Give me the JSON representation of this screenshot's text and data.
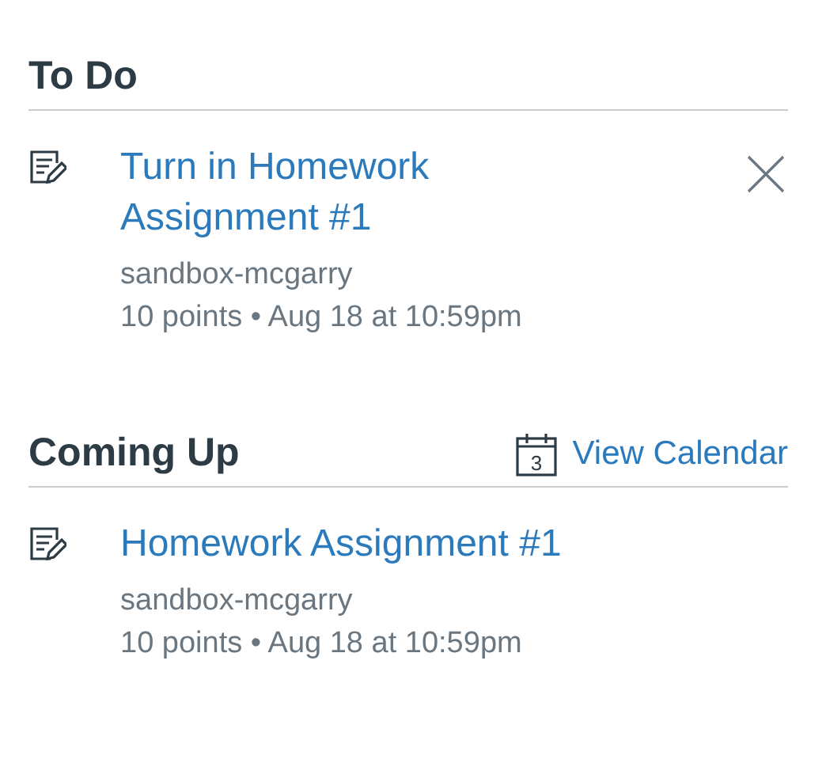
{
  "todo": {
    "title": "To Do",
    "items": [
      {
        "title": "Turn in Homework Assignment #1",
        "course": "sandbox-mcgarry",
        "meta": "10 points • Aug 18 at 10:59pm",
        "dismissible": true
      }
    ]
  },
  "coming_up": {
    "title": "Coming Up",
    "calendar_day": "3",
    "calendar_link": "View Calendar",
    "items": [
      {
        "title": "Homework Assignment #1",
        "course": "sandbox-mcgarry",
        "meta": "10 points • Aug 18 at 10:59pm",
        "dismissible": false
      }
    ]
  }
}
